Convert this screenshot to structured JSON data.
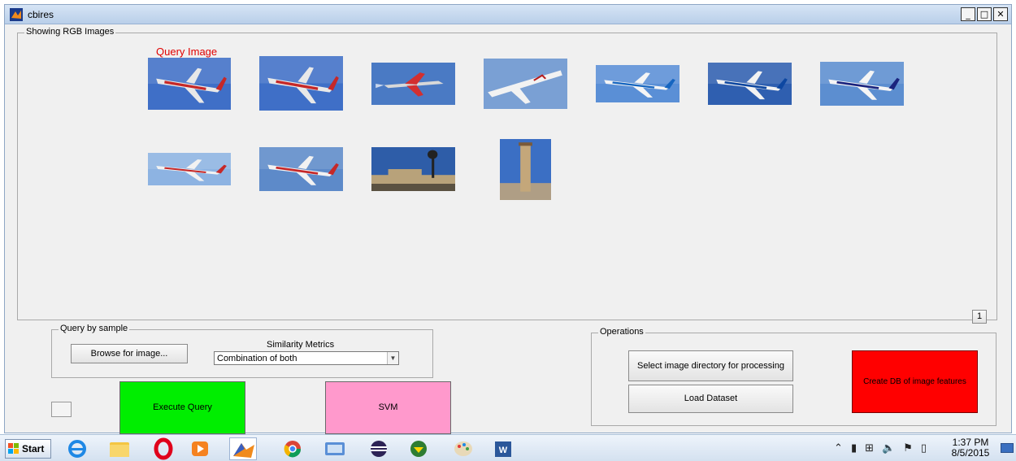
{
  "window": {
    "title": "cbires",
    "minimize_label": "_",
    "maximize_label": "□",
    "close_label": "✕"
  },
  "results_panel": {
    "title": "Showing RGB Images",
    "query_label": "Query Image",
    "page_number": "1",
    "thumbnails": [
      {
        "kind": "airplane",
        "body": "#e8e8e8",
        "accent": "#c62828",
        "sky": "#3f6fc7"
      },
      {
        "kind": "airplane",
        "body": "#e8e8e8",
        "accent": "#c62828",
        "sky": "#3f6fc7"
      },
      {
        "kind": "jet",
        "body": "#d8d8d8",
        "accent": "#d32f2f",
        "sky": "#4a7ac4"
      },
      {
        "kind": "small-plane",
        "body": "#f2f2f2",
        "accent": "#b71c1c",
        "sky": "#7aa0d4"
      },
      {
        "kind": "airplane",
        "body": "#f5f5f5",
        "accent": "#1565c0",
        "sky": "#5a8fd6"
      },
      {
        "kind": "airplane",
        "body": "#f2f2f2",
        "accent": "#0d47a1",
        "sky": "#2f5fb0"
      },
      {
        "kind": "airplane",
        "body": "#f5f5f5",
        "accent": "#1a237e",
        "sky": "#5c8ed0"
      },
      {
        "kind": "airplane",
        "body": "#f2f2f2",
        "accent": "#c62828",
        "sky": "#8db3e2"
      },
      {
        "kind": "airplane",
        "body": "#f2f2f2",
        "accent": "#c62828",
        "sky": "#5d8ac9"
      },
      {
        "kind": "building",
        "body": "#b8a27a",
        "accent": "#222222",
        "sky": "#2e5da8"
      },
      {
        "kind": "column",
        "body": "#c4a77a",
        "accent": "#7a5a3a",
        "sky": "#3b6fc4"
      }
    ]
  },
  "query_panel": {
    "title": "Query by sample",
    "browse_label": "Browse for image...",
    "similarity_label": "Similarity Metrics",
    "similarity_selected": "Combination of both"
  },
  "execute_label": "Execute Query",
  "svm_label": "SVM",
  "operations_panel": {
    "title": "Operations",
    "select_dir_label": "Select image directory for processing",
    "load_dataset_label": "Load Dataset",
    "create_db_label": "Create DB of image features"
  },
  "colors": {
    "execute_bg": "#00ee00",
    "svm_bg": "#ff99cc",
    "create_db_bg": "#ff0000",
    "query_label": "#e00000"
  },
  "taskbar": {
    "start_label": "Start",
    "apps": [
      "internet-explorer-icon",
      "file-explorer-icon",
      "opera-icon",
      "media-player-icon",
      "matlab-icon",
      "chrome-icon",
      "remote-desktop-icon",
      "eclipse-icon",
      "download-manager-icon",
      "paint-icon",
      "word-icon"
    ],
    "time": "1:37 PM",
    "date": "8/5/2015"
  }
}
